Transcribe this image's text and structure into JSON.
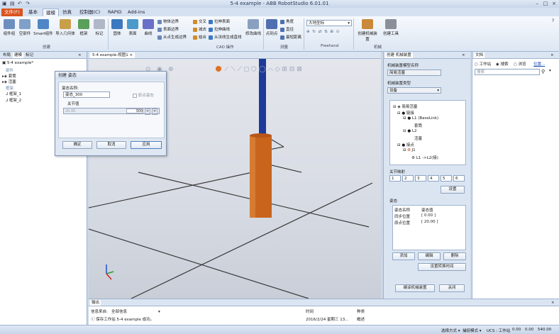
{
  "window": {
    "title": "5-4 example - ABB RobotStudio 6.01.01"
  },
  "ribbon_tabs": [
    "文件(F)",
    "基本",
    "建模",
    "仿真",
    "控制器(C)",
    "RAPID",
    "Add-Ins"
  ],
  "ribbon": {
    "create": [
      "组件组",
      "空部件",
      "Smart组件",
      "导入几何体",
      "框架",
      "标记"
    ],
    "shapes": [
      "固体",
      "表面",
      "曲线"
    ],
    "edge_items": [
      "物体边界",
      "表面边界",
      "从点生成边界"
    ],
    "cad_items_a": [
      "交叉",
      "减去",
      "结合"
    ],
    "cad_items_b": [
      "拉伸表面",
      "拉伸曲线",
      "从法线生成直线"
    ],
    "modify_curve": "修改曲线",
    "point_to_point": "点到点",
    "measure_items": [
      "角度",
      "直径",
      "最短距离"
    ],
    "freehand_combo": "大地坐标",
    "mechanism": [
      "创建机械装置",
      "创建工具"
    ],
    "groups": [
      "创建",
      "CAD 操作",
      "测量",
      "Freehand",
      "机械"
    ]
  },
  "left_panel": {
    "tabs": [
      "布局",
      "建模",
      "标记"
    ],
    "tree": [
      "5-4 example*",
      "部件",
      "套筒",
      "活塞",
      "框架",
      "框架_1",
      "框架_2"
    ]
  },
  "viewport": {
    "tab": "5-4 example:视图1"
  },
  "dialog": {
    "title": "创建 姿态",
    "name_label": "姿态名称:",
    "name_value": "姿态_300",
    "origin_checkbox": "原点姿态",
    "joint_label": "关节值",
    "joint_min": "20.00",
    "joint_value": "300",
    "buttons": [
      "确定",
      "取消",
      "应用"
    ]
  },
  "right_panel": {
    "tab": "创建 机械装置",
    "model_name_label": "机械装置模型名称",
    "model_name_value": "简易活塞",
    "type_label": "机械装置类型",
    "type_value": "设备",
    "tree": [
      "简易活塞",
      "链接",
      "L1 (BaseLink)",
      "套筒",
      "L2",
      "活塞",
      "接点",
      "J1",
      "L1 ->L2(接)"
    ],
    "joint_map_label": "关节映射",
    "joint_map_values": [
      "1",
      "2",
      "3",
      "4",
      "5",
      "6"
    ],
    "set_button": "设置",
    "pose_label": "姿态",
    "pose_headers": [
      "姿态名称",
      "姿态值"
    ],
    "poses": [
      {
        "name": "同步位置",
        "value": "[ 0.00 ]"
      },
      {
        "name": "原点位置",
        "value": "[ 20.00 ]"
      }
    ],
    "pose_buttons": [
      "添加",
      "编辑",
      "删除"
    ],
    "transition_button": "设置转换时间",
    "compile_button": "编译机械装置",
    "close_button": "关闭"
  },
  "doc_panel": {
    "tab": "文档",
    "radios": [
      "工作站",
      "搜索",
      "浏览"
    ],
    "location": "位置...",
    "search_placeholder": "搜索"
  },
  "output": {
    "tab": "输出",
    "headers": [
      "信息来自:",
      "全部信息",
      "时间",
      "种类"
    ],
    "rows": [
      {
        "message": "保存工作站 5-4 example 成功。",
        "time": "2016/2/24 星期三 13...",
        "type": "概述"
      }
    ]
  },
  "statusbar": {
    "select": "选择方式 ▾",
    "snap": "捕捉模式 ▾",
    "ucs": "UCS : 工作站",
    "coords": [
      "0.00",
      "0.00",
      "540.00"
    ]
  },
  "colors": {
    "file_tab": "#d9531e",
    "cylinder": "#c8641c",
    "rod": "#1d3a9a"
  }
}
